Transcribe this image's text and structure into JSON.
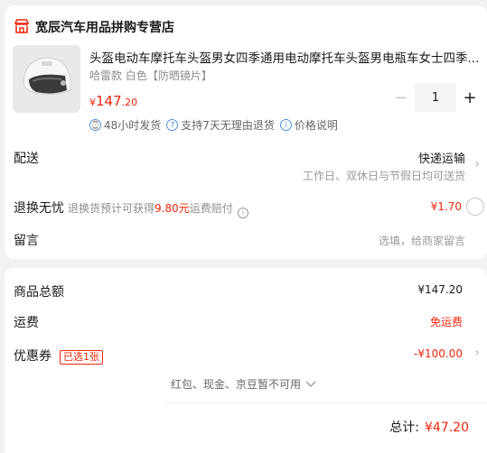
{
  "store": {
    "name": "宽辰汽车用品拼购专营店",
    "icon": "storefront-icon"
  },
  "product": {
    "title": "头盔电动车摩托车头盔男女四季通用电动摩托车头盔男电瓶车女士四季...",
    "variant": "哈雷款 白色【防晒镜片】",
    "price_currency": "¥",
    "price_int": "147",
    "price_dec": ".20",
    "quantity": "1",
    "minus": "−",
    "plus": "+"
  },
  "services": [
    {
      "icon": "clock-icon",
      "glyph": "⌚",
      "label": "48小时发货"
    },
    {
      "icon": "seven-day-icon",
      "glyph": "7",
      "label": "支持7天无理由退货"
    },
    {
      "icon": "info-icon",
      "glyph": "i",
      "label": "价格说明"
    }
  ],
  "delivery": {
    "label": "配送",
    "method": "快递运输",
    "note": "工作日、双休日与节假日均可送货"
  },
  "insurance": {
    "label": "退换无忧",
    "desc_prefix": "退换货预计可获得",
    "desc_amount": "9.80元",
    "desc_suffix": "运费赔付",
    "price": "¥1.70"
  },
  "message": {
    "label": "留言",
    "placeholder": "选填，给商家留言"
  },
  "summary": {
    "goods_label": "商品总额",
    "goods_value": "¥147.20",
    "shipping_label": "运费",
    "shipping_value": "免运费",
    "coupon_label": "优惠券",
    "coupon_tag": "已选1张",
    "coupon_value": "-¥100.00",
    "unusable_note": "红包、现金、京豆暂不可用",
    "total_label": "总计:",
    "total_value": "¥47.20"
  },
  "colors": {
    "accent_red": "#f2270c",
    "info_blue": "#4a90e2"
  }
}
